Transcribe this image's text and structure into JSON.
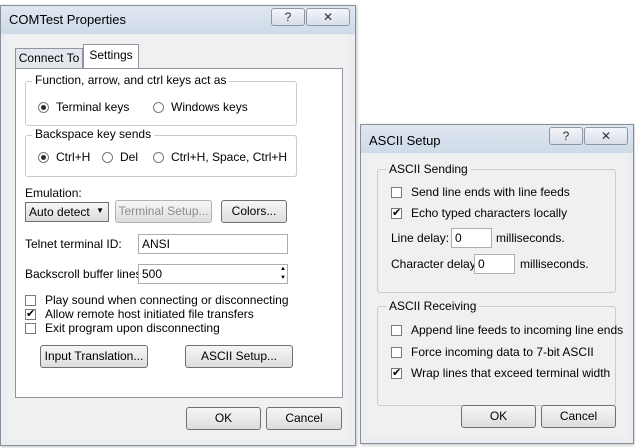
{
  "comtest": {
    "title": "COMTest Properties",
    "help_glyph": "?",
    "close_glyph": "✕",
    "tabs": [
      "Connect To",
      "Settings"
    ],
    "keys_group": {
      "label": "Function, arrow, and ctrl keys act as",
      "options": [
        {
          "label": "Terminal keys",
          "selected": true
        },
        {
          "label": "Windows keys",
          "selected": false
        }
      ]
    },
    "backspace_group": {
      "label": "Backspace key sends",
      "options": [
        {
          "label": "Ctrl+H",
          "selected": true
        },
        {
          "label": "Del",
          "selected": false
        },
        {
          "label": "Ctrl+H, Space, Ctrl+H",
          "selected": false
        }
      ]
    },
    "emulation": {
      "label": "Emulation:",
      "value": "Auto detect",
      "arrow": "▼"
    },
    "terminal_setup_label": "Terminal Setup...",
    "colors_label": "Colors...",
    "telnet": {
      "label": "Telnet terminal ID:",
      "value": "ANSI"
    },
    "backscroll": {
      "label": "Backscroll buffer lines:",
      "value": "500",
      "up": "▲",
      "down": "▼"
    },
    "checks": [
      {
        "label": "Play sound when connecting or disconnecting",
        "checked": false
      },
      {
        "label": "Allow remote host initiated file transfers",
        "checked": true
      },
      {
        "label": "Exit program upon disconnecting",
        "checked": false
      }
    ],
    "input_translation_label": "Input Translation...",
    "ascii_setup_label": "ASCII Setup...",
    "ok_label": "OK",
    "cancel_label": "Cancel"
  },
  "ascii": {
    "title": "ASCII Setup",
    "help_glyph": "?",
    "close_glyph": "✕",
    "sending": {
      "label": "ASCII Sending",
      "checks": [
        {
          "label": "Send line ends with line feeds",
          "checked": false
        },
        {
          "label": "Echo typed characters locally",
          "checked": true
        }
      ],
      "line_delay": {
        "label": "Line delay:",
        "value": "0",
        "unit": "milliseconds."
      },
      "char_delay": {
        "label": "Character delay:",
        "value": "0",
        "unit": "milliseconds."
      }
    },
    "receiving": {
      "label": "ASCII Receiving",
      "checks": [
        {
          "label": "Append line feeds to incoming line ends",
          "checked": false
        },
        {
          "label": "Force incoming data to 7-bit ASCII",
          "checked": false
        },
        {
          "label": "Wrap lines that exceed terminal width",
          "checked": true
        }
      ]
    },
    "ok_label": "OK",
    "cancel_label": "Cancel"
  },
  "check_glyph": "✔"
}
